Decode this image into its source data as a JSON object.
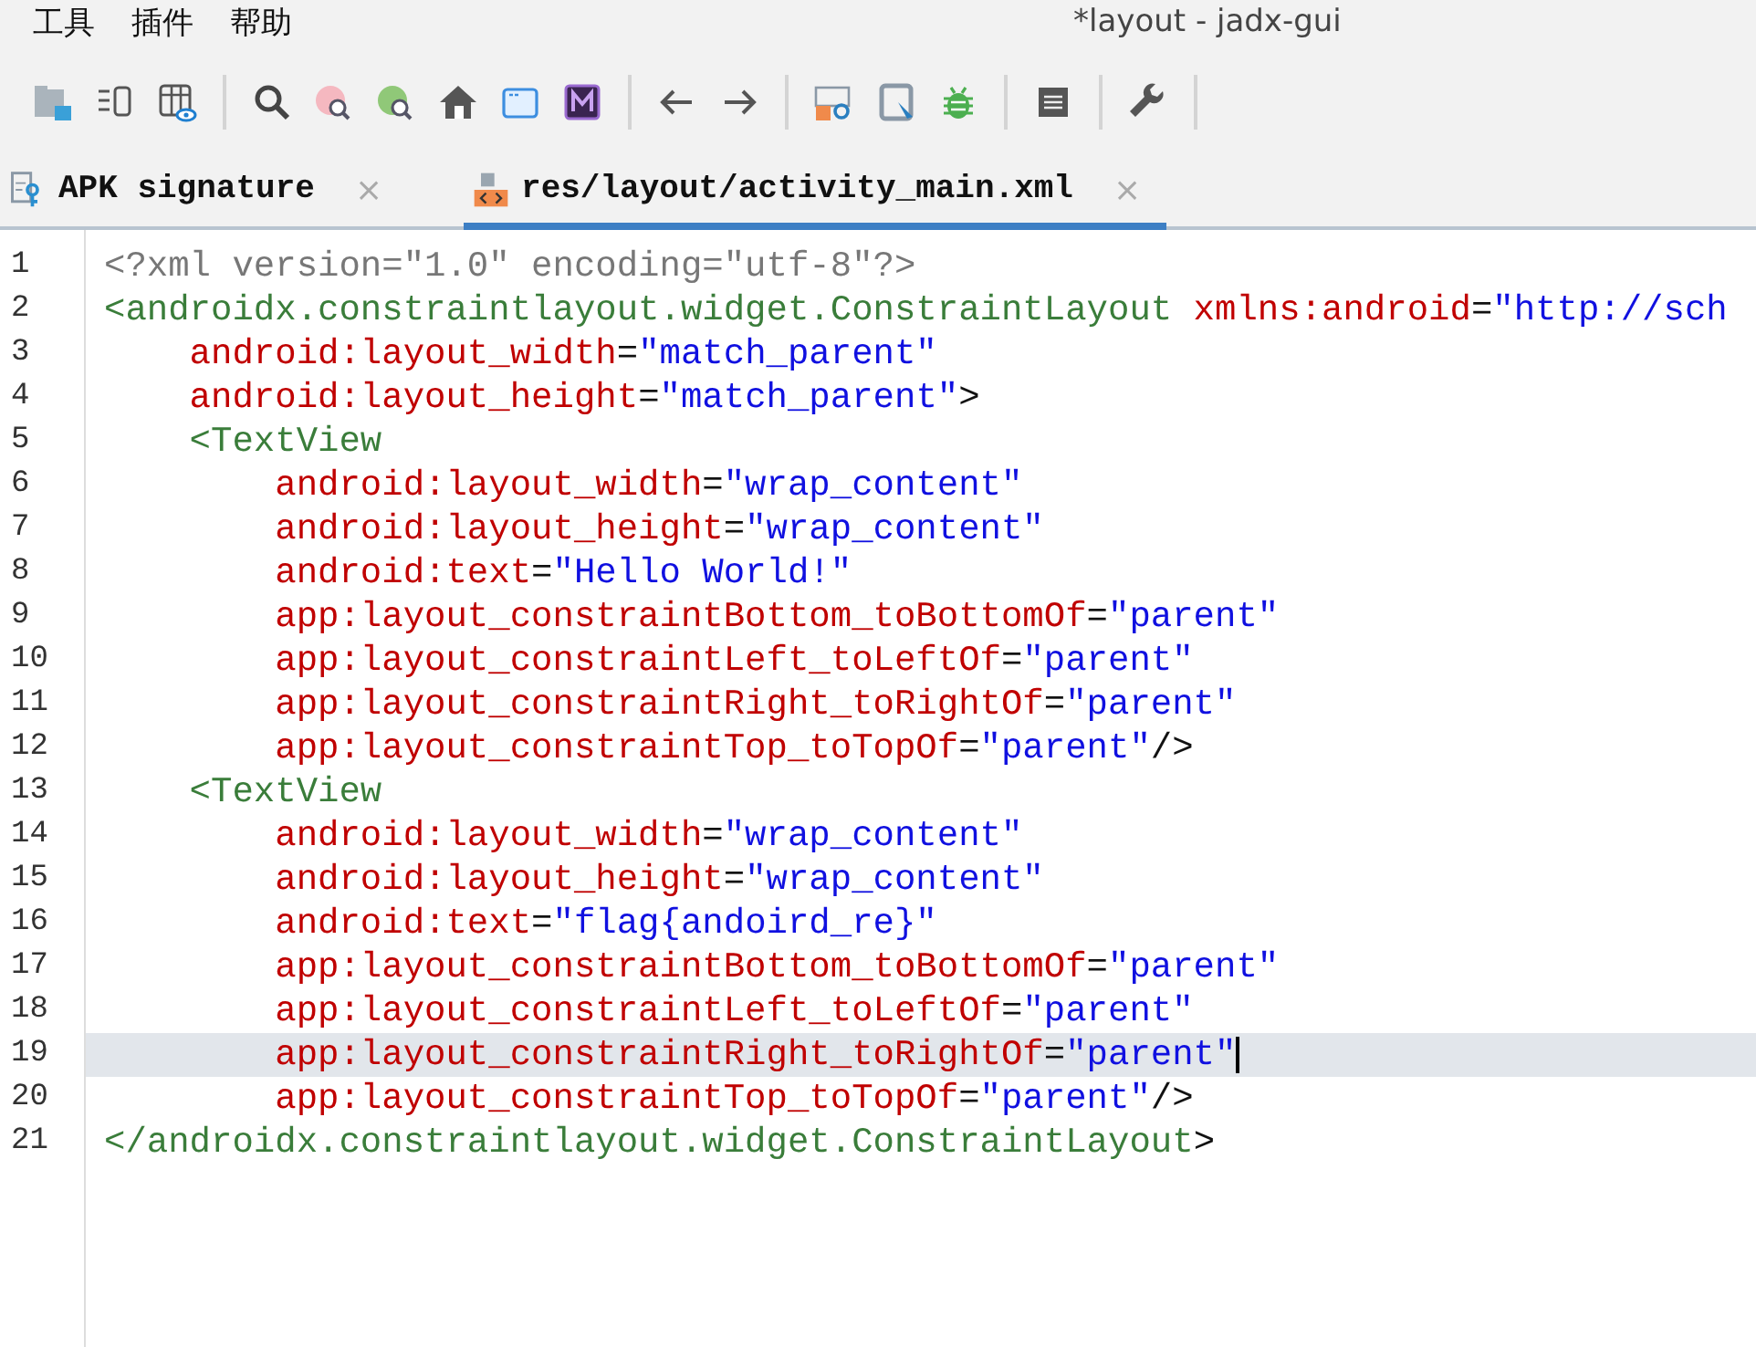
{
  "menu": [
    "工具",
    "插件",
    "帮助"
  ],
  "window": {
    "title": "*layout - jadx-gui"
  },
  "tabs": [
    {
      "label": "APK signature",
      "selected": false,
      "close": "×",
      "kind": "signature"
    },
    {
      "label": "res/layout/activity_main.xml",
      "selected": true,
      "close": "×",
      "kind": "xml"
    }
  ],
  "editor": {
    "lines": [
      {
        "number": "1",
        "current": false,
        "tokens": [
          {
            "kind": "prolog",
            "text": "<?xml version=\"1.0\" encoding=\"utf-8\"?>"
          }
        ]
      },
      {
        "number": "2",
        "current": false,
        "tokens": [
          {
            "kind": "tag",
            "text": "<androidx.constraintlayout.widget.ConstraintLayout"
          },
          {
            "kind": "attr",
            "text": " xmlns:android"
          },
          {
            "kind": "plain",
            "text": "="
          },
          {
            "kind": "value",
            "text": "\"http://sch"
          }
        ]
      },
      {
        "number": "3",
        "current": false,
        "tokens": [
          {
            "kind": "attr",
            "text": "    android:layout_width"
          },
          {
            "kind": "plain",
            "text": "="
          },
          {
            "kind": "value",
            "text": "\"match_parent\""
          }
        ]
      },
      {
        "number": "4",
        "current": false,
        "tokens": [
          {
            "kind": "attr",
            "text": "    android:layout_height"
          },
          {
            "kind": "plain",
            "text": "="
          },
          {
            "kind": "value",
            "text": "\"match_parent\""
          },
          {
            "kind": "plain",
            "text": ">"
          }
        ]
      },
      {
        "number": "5",
        "current": false,
        "tokens": [
          {
            "kind": "tag",
            "text": "    <TextView"
          }
        ]
      },
      {
        "number": "6",
        "current": false,
        "tokens": [
          {
            "kind": "attr",
            "text": "        android:layout_width"
          },
          {
            "kind": "plain",
            "text": "="
          },
          {
            "kind": "value",
            "text": "\"wrap_content\""
          }
        ]
      },
      {
        "number": "7",
        "current": false,
        "tokens": [
          {
            "kind": "attr",
            "text": "        android:layout_height"
          },
          {
            "kind": "plain",
            "text": "="
          },
          {
            "kind": "value",
            "text": "\"wrap_content\""
          }
        ]
      },
      {
        "number": "8",
        "current": false,
        "tokens": [
          {
            "kind": "attr",
            "text": "        android:text"
          },
          {
            "kind": "plain",
            "text": "="
          },
          {
            "kind": "value",
            "text": "\"Hello World!\""
          }
        ]
      },
      {
        "number": "9",
        "current": false,
        "tokens": [
          {
            "kind": "attr",
            "text": "        app:layout_constraintBottom_toBottomOf"
          },
          {
            "kind": "plain",
            "text": "="
          },
          {
            "kind": "value",
            "text": "\"parent\""
          }
        ]
      },
      {
        "number": "10",
        "current": false,
        "tokens": [
          {
            "kind": "attr",
            "text": "        app:layout_constraintLeft_toLeftOf"
          },
          {
            "kind": "plain",
            "text": "="
          },
          {
            "kind": "value",
            "text": "\"parent\""
          }
        ]
      },
      {
        "number": "11",
        "current": false,
        "tokens": [
          {
            "kind": "attr",
            "text": "        app:layout_constraintRight_toRightOf"
          },
          {
            "kind": "plain",
            "text": "="
          },
          {
            "kind": "value",
            "text": "\"parent\""
          }
        ]
      },
      {
        "number": "12",
        "current": false,
        "tokens": [
          {
            "kind": "attr",
            "text": "        app:layout_constraintTop_toTopOf"
          },
          {
            "kind": "plain",
            "text": "="
          },
          {
            "kind": "value",
            "text": "\"parent\""
          },
          {
            "kind": "plain",
            "text": "/>"
          }
        ]
      },
      {
        "number": "13",
        "current": false,
        "tokens": [
          {
            "kind": "tag",
            "text": "    <TextView"
          }
        ]
      },
      {
        "number": "14",
        "current": false,
        "tokens": [
          {
            "kind": "attr",
            "text": "        android:layout_width"
          },
          {
            "kind": "plain",
            "text": "="
          },
          {
            "kind": "value",
            "text": "\"wrap_content\""
          }
        ]
      },
      {
        "number": "15",
        "current": false,
        "tokens": [
          {
            "kind": "attr",
            "text": "        android:layout_height"
          },
          {
            "kind": "plain",
            "text": "="
          },
          {
            "kind": "value",
            "text": "\"wrap_content\""
          }
        ]
      },
      {
        "number": "16",
        "current": false,
        "tokens": [
          {
            "kind": "attr",
            "text": "        android:text"
          },
          {
            "kind": "plain",
            "text": "="
          },
          {
            "kind": "value",
            "text": "\"flag{andoird_re}\""
          }
        ]
      },
      {
        "number": "17",
        "current": false,
        "tokens": [
          {
            "kind": "attr",
            "text": "        app:layout_constraintBottom_toBottomOf"
          },
          {
            "kind": "plain",
            "text": "="
          },
          {
            "kind": "value",
            "text": "\"parent\""
          }
        ]
      },
      {
        "number": "18",
        "current": false,
        "tokens": [
          {
            "kind": "attr",
            "text": "        app:layout_constraintLeft_toLeftOf"
          },
          {
            "kind": "plain",
            "text": "="
          },
          {
            "kind": "value",
            "text": "\"parent\""
          }
        ]
      },
      {
        "number": "19",
        "current": true,
        "tokens": [
          {
            "kind": "attr",
            "text": "        app:layout_constraintRight_toRightOf"
          },
          {
            "kind": "plain",
            "text": "="
          },
          {
            "kind": "value",
            "text": "\"parent\""
          }
        ]
      },
      {
        "number": "20",
        "current": false,
        "tokens": [
          {
            "kind": "attr",
            "text": "        app:layout_constraintTop_toTopOf"
          },
          {
            "kind": "plain",
            "text": "="
          },
          {
            "kind": "value",
            "text": "\"parent\""
          },
          {
            "kind": "plain",
            "text": "/>"
          }
        ]
      },
      {
        "number": "21",
        "current": false,
        "tokens": [
          {
            "kind": "tag",
            "text": "</androidx.constraintlayout.widget.ConstraintLayout"
          },
          {
            "kind": "plain",
            "text": ">"
          }
        ]
      }
    ]
  }
}
